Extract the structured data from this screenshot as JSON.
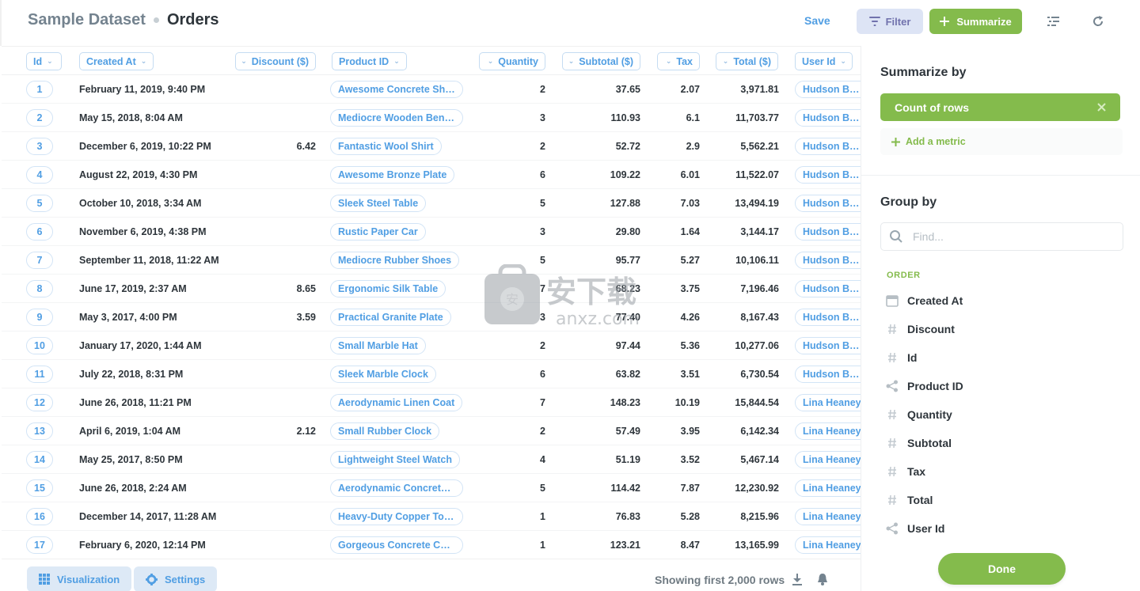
{
  "header": {
    "database": "Sample Dataset",
    "table": "Orders",
    "save_label": "Save",
    "filter_label": "Filter",
    "summarize_label": "Summarize"
  },
  "columns": [
    "Id",
    "Created At",
    "Discount ($)",
    "Product ID",
    "Quantity",
    "Subtotal ($)",
    "Tax",
    "Total ($)",
    "User Id"
  ],
  "rows": [
    {
      "id": "1",
      "created_at": "February 11, 2019, 9:40 PM",
      "discount": "",
      "product": "Awesome Concrete Shoes",
      "quantity": "2",
      "subtotal": "37.65",
      "tax": "2.07",
      "total": "3,971.81",
      "user": "Hudson Borer"
    },
    {
      "id": "2",
      "created_at": "May 15, 2018, 8:04 AM",
      "discount": "",
      "product": "Mediocre Wooden Bench",
      "quantity": "3",
      "subtotal": "110.93",
      "tax": "6.1",
      "total": "11,703.77",
      "user": "Hudson Borer"
    },
    {
      "id": "3",
      "created_at": "December 6, 2019, 10:22 PM",
      "discount": "6.42",
      "product": "Fantastic Wool Shirt",
      "quantity": "2",
      "subtotal": "52.72",
      "tax": "2.9",
      "total": "5,562.21",
      "user": "Hudson Borer"
    },
    {
      "id": "4",
      "created_at": "August 22, 2019, 4:30 PM",
      "discount": "",
      "product": "Awesome Bronze Plate",
      "quantity": "6",
      "subtotal": "109.22",
      "tax": "6.01",
      "total": "11,522.07",
      "user": "Hudson Borer"
    },
    {
      "id": "5",
      "created_at": "October 10, 2018, 3:34 AM",
      "discount": "",
      "product": "Sleek Steel Table",
      "quantity": "5",
      "subtotal": "127.88",
      "tax": "7.03",
      "total": "13,494.19",
      "user": "Hudson Borer"
    },
    {
      "id": "6",
      "created_at": "November 6, 2019, 4:38 PM",
      "discount": "",
      "product": "Rustic Paper Car",
      "quantity": "3",
      "subtotal": "29.80",
      "tax": "1.64",
      "total": "3,144.17",
      "user": "Hudson Borer"
    },
    {
      "id": "7",
      "created_at": "September 11, 2018, 11:22 AM",
      "discount": "",
      "product": "Mediocre Rubber Shoes",
      "quantity": "5",
      "subtotal": "95.77",
      "tax": "5.27",
      "total": "10,106.11",
      "user": "Hudson Borer"
    },
    {
      "id": "8",
      "created_at": "June 17, 2019, 2:37 AM",
      "discount": "8.65",
      "product": "Ergonomic Silk Table",
      "quantity": "7",
      "subtotal": "68.23",
      "tax": "3.75",
      "total": "7,196.46",
      "user": "Hudson Borer"
    },
    {
      "id": "9",
      "created_at": "May 3, 2017, 4:00 PM",
      "discount": "3.59",
      "product": "Practical Granite Plate",
      "quantity": "3",
      "subtotal": "77.40",
      "tax": "4.26",
      "total": "8,167.43",
      "user": "Hudson Borer"
    },
    {
      "id": "10",
      "created_at": "January 17, 2020, 1:44 AM",
      "discount": "",
      "product": "Small Marble Hat",
      "quantity": "2",
      "subtotal": "97.44",
      "tax": "5.36",
      "total": "10,277.06",
      "user": "Hudson Borer"
    },
    {
      "id": "11",
      "created_at": "July 22, 2018, 8:31 PM",
      "discount": "",
      "product": "Sleek Marble Clock",
      "quantity": "6",
      "subtotal": "63.82",
      "tax": "3.51",
      "total": "6,730.54",
      "user": "Hudson Borer"
    },
    {
      "id": "12",
      "created_at": "June 26, 2018, 11:21 PM",
      "discount": "",
      "product": "Aerodynamic Linen Coat",
      "quantity": "7",
      "subtotal": "148.23",
      "tax": "10.19",
      "total": "15,844.54",
      "user": "Lina Heaney"
    },
    {
      "id": "13",
      "created_at": "April 6, 2019, 1:04 AM",
      "discount": "2.12",
      "product": "Small Rubber Clock",
      "quantity": "2",
      "subtotal": "57.49",
      "tax": "3.95",
      "total": "6,142.34",
      "user": "Lina Heaney"
    },
    {
      "id": "14",
      "created_at": "May 25, 2017, 8:50 PM",
      "discount": "",
      "product": "Lightweight Steel Watch",
      "quantity": "4",
      "subtotal": "51.19",
      "tax": "3.52",
      "total": "5,467.14",
      "user": "Lina Heaney"
    },
    {
      "id": "15",
      "created_at": "June 26, 2018, 2:24 AM",
      "discount": "",
      "product": "Aerodynamic Concrete ...",
      "quantity": "5",
      "subtotal": "114.42",
      "tax": "7.87",
      "total": "12,230.92",
      "user": "Lina Heaney"
    },
    {
      "id": "16",
      "created_at": "December 14, 2017, 11:28 AM",
      "discount": "",
      "product": "Heavy-Duty Copper Tou...",
      "quantity": "1",
      "subtotal": "76.83",
      "tax": "5.28",
      "total": "8,215.96",
      "user": "Lina Heaney"
    },
    {
      "id": "17",
      "created_at": "February 6, 2020, 12:14 PM",
      "discount": "",
      "product": "Gorgeous Concrete Chair",
      "quantity": "1",
      "subtotal": "123.21",
      "tax": "8.47",
      "total": "13,165.99",
      "user": "Lina Heaney"
    }
  ],
  "footer": {
    "visualization_label": "Visualization",
    "settings_label": "Settings",
    "row_count_text": "Showing first 2,000 rows"
  },
  "sidebar": {
    "summarize_title": "Summarize by",
    "metric_label": "Count of rows",
    "add_metric_label": "Add a metric",
    "group_title": "Group by",
    "find_placeholder": "Find...",
    "section_label": "ORDER",
    "dimensions": [
      {
        "label": "Created At",
        "icon": "calendar-icon"
      },
      {
        "label": "Discount",
        "icon": "number-icon"
      },
      {
        "label": "Id",
        "icon": "number-icon"
      },
      {
        "label": "Product ID",
        "icon": "connection-icon"
      },
      {
        "label": "Quantity",
        "icon": "number-icon"
      },
      {
        "label": "Subtotal",
        "icon": "number-icon"
      },
      {
        "label": "Tax",
        "icon": "number-icon"
      },
      {
        "label": "Total",
        "icon": "number-icon"
      },
      {
        "label": "User Id",
        "icon": "connection-icon"
      }
    ],
    "done_label": "Done"
  },
  "watermark": {
    "text": "安下载",
    "sub": "anxz.com"
  },
  "colors": {
    "brand": "#509ee3",
    "summarize": "#84bb4c",
    "filter": "#7172ad"
  }
}
